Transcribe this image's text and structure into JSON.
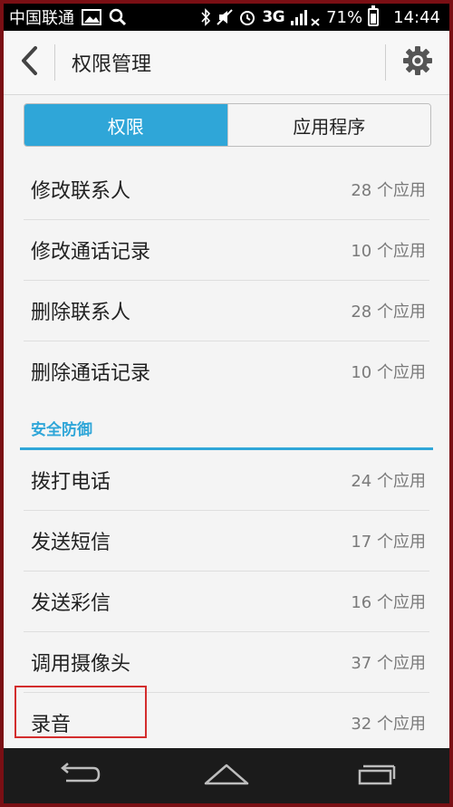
{
  "status_bar": {
    "carrier": "中国联通",
    "network": "3G",
    "battery": "71%",
    "time": "14:44",
    "icons": [
      "image-icon",
      "search-icon",
      "bluetooth-icon",
      "mute-icon",
      "alarm-icon",
      "signal-icon",
      "battery-icon"
    ]
  },
  "action_bar": {
    "title": "权限管理",
    "back_icon": "chevron-left-icon",
    "settings_icon": "gear-icon"
  },
  "tabs": [
    {
      "label": "权限",
      "active": true
    },
    {
      "label": "应用程序",
      "active": false
    }
  ],
  "list_top": [
    {
      "label": "修改联系人",
      "count": "28 个应用"
    },
    {
      "label": "修改通话记录",
      "count": "10 个应用"
    },
    {
      "label": "删除联系人",
      "count": "28 个应用"
    },
    {
      "label": "删除通话记录",
      "count": "10 个应用"
    }
  ],
  "section": {
    "title": "安全防御"
  },
  "list_bottom": [
    {
      "label": "拨打电话",
      "count": "24 个应用"
    },
    {
      "label": "发送短信",
      "count": "17 个应用"
    },
    {
      "label": "发送彩信",
      "count": "16 个应用"
    },
    {
      "label": "调用摄像头",
      "count": "37 个应用"
    },
    {
      "label": "录音",
      "count": "32 个应用"
    }
  ],
  "nav_bar": {
    "icons": [
      "back-nav-icon",
      "home-nav-icon",
      "recents-nav-icon"
    ]
  },
  "colors": {
    "accent": "#2fa6d8",
    "highlight": "#d32d2d",
    "frame": "#7a0f14"
  }
}
